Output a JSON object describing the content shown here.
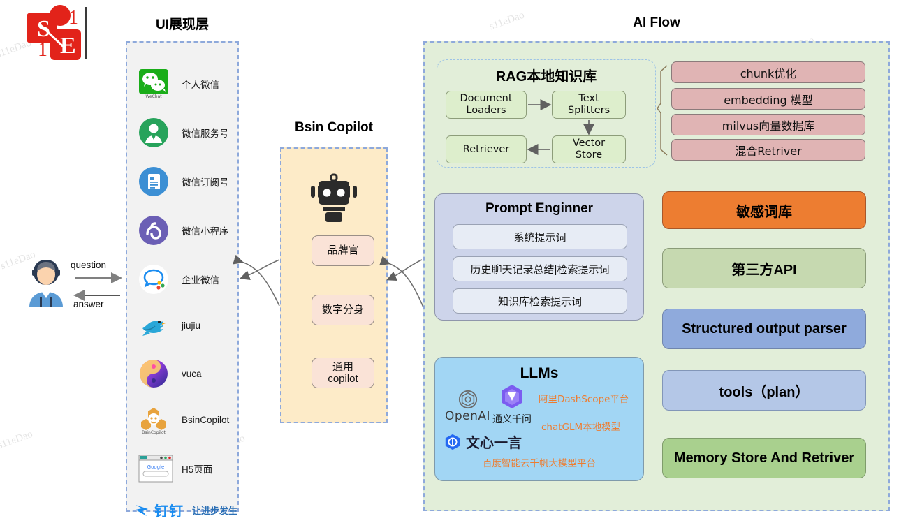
{
  "logo": {
    "alt": "s1e-logo",
    "letters": [
      "S",
      "1",
      "1",
      "E"
    ]
  },
  "sections": {
    "ui_layer_title": "UI展现层",
    "copilot_title": "Bsin Copilot",
    "aiflow_title": "AI Flow"
  },
  "user": {
    "avatar_name": "user-avatar",
    "question_label": "question",
    "answer_label": "answer"
  },
  "ui_layer": {
    "items": [
      {
        "label": "个人微信",
        "icon": "wechat-icon"
      },
      {
        "label": "微信服务号",
        "icon": "wechat-service-account-icon"
      },
      {
        "label": "微信订阅号",
        "icon": "wechat-subscription-account-icon"
      },
      {
        "label": "微信小程序",
        "icon": "wechat-miniprogram-icon"
      },
      {
        "label": "企业微信",
        "icon": "wecom-icon"
      },
      {
        "label": "jiujiu",
        "icon": "jiujiu-bird-icon"
      },
      {
        "label": "vuca",
        "icon": "vuca-icon"
      },
      {
        "label": "BsinCopilot",
        "icon": "bsincopilot-icon"
      },
      {
        "label": "H5页面",
        "icon": "browser-window-icon"
      }
    ],
    "footer": {
      "label": "钉钉",
      "slogan": "让进步发生",
      "icon": "dingtalk-icon"
    },
    "wechat_icon_caption": "WeChat",
    "bsincopilot_icon_caption": "BsinCopilot",
    "browser_icon_caption": "Google"
  },
  "copilot": {
    "robot_icon": "robot-icon",
    "boxes": [
      {
        "lines": [
          "品牌官"
        ]
      },
      {
        "lines": [
          "数字分身"
        ]
      },
      {
        "lines": [
          "通用",
          "copilot"
        ]
      }
    ]
  },
  "rag": {
    "title": "RAG本地知识库",
    "nodes": [
      {
        "lines": [
          "Document",
          "Loaders"
        ]
      },
      {
        "lines": [
          "Text",
          "Splitters"
        ]
      },
      {
        "lines": [
          "Vector",
          "Store"
        ]
      },
      {
        "lines": [
          "Retriever"
        ]
      }
    ],
    "options": [
      "chunk优化",
      "embedding 模型",
      "milvus向量数据库",
      "混合Retriver"
    ]
  },
  "prompt_engineer": {
    "title": "Prompt Enginner",
    "items": [
      "系统提示词",
      "历史聊天记录总结|检索提示词",
      "知识库检索提示词"
    ]
  },
  "llms": {
    "title": "LLMs",
    "brands": [
      {
        "name": "OpenAI",
        "icon": "openai-icon"
      },
      {
        "name": "通义千问",
        "icon": "tongyi-qianwen-icon"
      },
      {
        "name": "文心一言",
        "icon": "wenxin-yiyan-icon"
      }
    ],
    "notes": [
      "阿里DashScope平台",
      "chatGLM本地模型",
      "百度智能云千帆大模型平台"
    ]
  },
  "capabilities": [
    {
      "label": "敏感词库",
      "color": "#ed7d31",
      "border": "#a8572a"
    },
    {
      "label": "第三方API",
      "color": "#c6d9b0",
      "border": "#8a9b78"
    },
    {
      "label": "Structured output parser",
      "color": "#8faadc",
      "border": "#7085ad"
    },
    {
      "label": "tools（plan）",
      "color": "#b4c7e7",
      "border": "#8296b8"
    },
    {
      "label": "Memory Store And Retriver",
      "color": "#a9d08e",
      "border": "#7f9c6b"
    }
  ],
  "watermark": {
    "text": "s11eDao"
  },
  "colors": {
    "panel_border": "#8ea9db",
    "ui_panel_bg": "#f2f2f2",
    "copilot_panel_bg": "#fdebc8",
    "aiflow_panel_bg": "#e2eed9",
    "rag_node_bg": "#ddeecc",
    "pink_box_bg": "#e0b4b4",
    "prompt_bg": "#cdd4ea",
    "llm_bg": "#a2d6f4",
    "accent_orange": "#ed7d31",
    "logo_red": "#e2231a"
  }
}
